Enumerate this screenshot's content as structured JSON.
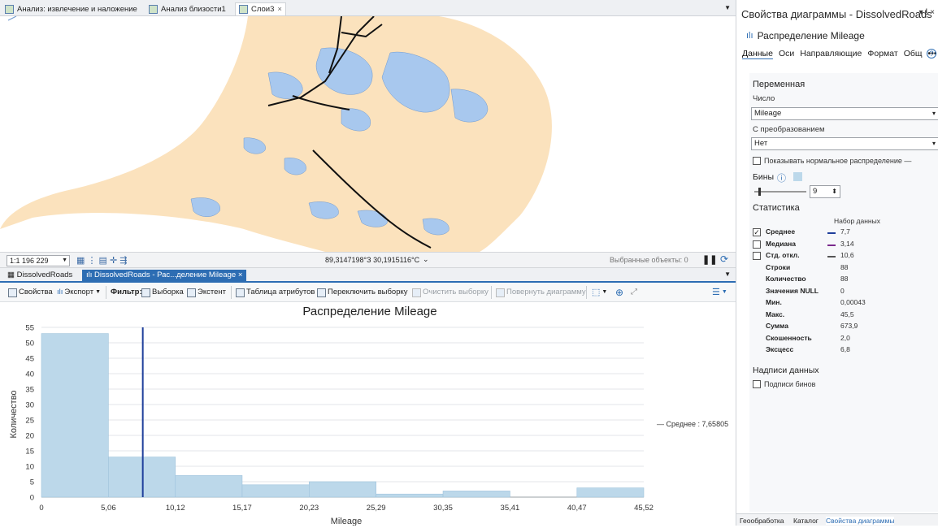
{
  "map_tabs": [
    {
      "label": "Анализ: извлечение и наложение"
    },
    {
      "label": "Анализ близости1"
    },
    {
      "label": "Слои3",
      "close": "×"
    }
  ],
  "map_status": {
    "scale": "1:1 196 229",
    "coords": "89,3147198°З 30,1915116°С",
    "selected": "Выбранные объекты: 0"
  },
  "chart_tabs": [
    {
      "label": "DissolvedRoads"
    },
    {
      "label": "DissolvedRoads - Рас...деление Mileage",
      "close": "×"
    }
  ],
  "toolbar": {
    "properties": "Свойства",
    "export": "Экспорт",
    "filter": "Фильтр:",
    "selection": "Выборка",
    "extent": "Экстент",
    "attr_table": "Таблица атрибутов",
    "switch_sel": "Переключить выборку",
    "clear_sel": "Очистить выборку",
    "rotate": "Повернуть диаграмму"
  },
  "chart_data": {
    "type": "bar",
    "title": "Распределение Mileage",
    "xlabel": "Mileage",
    "ylabel": "Количество",
    "bin_edges": [
      0,
      5.06,
      10.12,
      15.17,
      20.23,
      25.29,
      30.35,
      35.41,
      40.47,
      45.52
    ],
    "x_tick_labels": [
      "0",
      "5,06",
      "10,12",
      "15,17",
      "20,23",
      "25,29",
      "30,35",
      "35,41",
      "40,47",
      "45,52"
    ],
    "values": [
      53,
      13,
      7,
      4,
      5,
      1,
      2,
      0,
      3
    ],
    "ylim": [
      0,
      55
    ],
    "y_ticks": [
      0,
      5,
      10,
      15,
      20,
      25,
      30,
      35,
      40,
      45,
      50,
      55
    ],
    "mean": 7.65805,
    "mean_label": "— Среднее : 7,65805",
    "grid": true,
    "bar_color": "#bcd8ea",
    "mean_color": "#1f3f9b"
  },
  "pane": {
    "title": "Свойства диаграммы - DissolvedRoads",
    "pin": "▾ ⵑ ×",
    "chart_name": "Распределение Mileage",
    "tabs": [
      "Данные",
      "Оси",
      "Направляющие",
      "Формат",
      "Общ",
      "•••"
    ],
    "variable_header": "Переменная",
    "number_label": "Число",
    "number_value": "Mileage",
    "transform_label": "С преобразованием",
    "transform_value": "Нет",
    "show_normal": "Показывать нормальное распределение",
    "bins_label": "Бины",
    "bins_value": "9",
    "stats_header": "Статистика",
    "dataset_label": "Набор данных",
    "stats": [
      {
        "key": "Среднее",
        "value": "7,7",
        "checked": true,
        "color": "#1f3f9b"
      },
      {
        "key": "Медиана",
        "value": "3,14",
        "checked": false,
        "color": "#7a2a8c"
      },
      {
        "key": "Стд. откл.",
        "value": "10,6",
        "checked": false,
        "color": "#555555"
      },
      {
        "key": "Строки",
        "value": "88"
      },
      {
        "key": "Количество",
        "value": "88"
      },
      {
        "key": "Значения NULL",
        "value": "0"
      },
      {
        "key": "Мин.",
        "value": "0,00043"
      },
      {
        "key": "Макс.",
        "value": "45,5"
      },
      {
        "key": "Сумма",
        "value": "673,9"
      },
      {
        "key": "Скошенность",
        "value": "2,0"
      },
      {
        "key": "Эксцесс",
        "value": "6,8"
      }
    ],
    "labels_header": "Надписи данных",
    "bin_labels": "Подписи бинов",
    "bottom_tabs": [
      "Геообработка",
      "Каталог",
      "Свойства диаграммы"
    ]
  }
}
